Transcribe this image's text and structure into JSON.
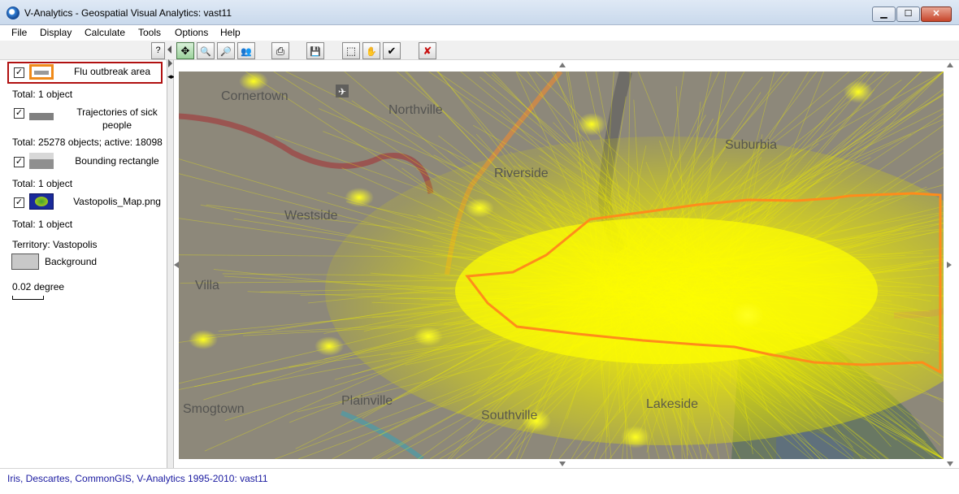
{
  "window": {
    "title": "V-Analytics - Geospatial Visual Analytics: vast11",
    "controls": {
      "minimize": "▁",
      "maximize": "☐",
      "close": "✕"
    }
  },
  "menu": [
    "File",
    "Display",
    "Calculate",
    "Tools",
    "Options",
    "Help"
  ],
  "toolbar": {
    "help_label": "?",
    "buttons": [
      {
        "name": "pan-grid-icon",
        "glyph": "✥",
        "active": true
      },
      {
        "name": "zoom-in-icon",
        "glyph": "🔍"
      },
      {
        "name": "zoom-out-icon",
        "glyph": "🔎"
      },
      {
        "name": "find-people-icon",
        "glyph": "👥"
      },
      {
        "name": "print-icon",
        "glyph": "⎙"
      },
      {
        "name": "save-icon",
        "glyph": "💾"
      },
      {
        "name": "select-rectangle-icon",
        "glyph": "⬚"
      },
      {
        "name": "hand-icon",
        "glyph": "✋"
      },
      {
        "name": "checkmark-icon",
        "glyph": "✔"
      },
      {
        "name": "remove-icon",
        "glyph": "✘"
      }
    ]
  },
  "legend": {
    "layers": [
      {
        "label": "Flu outbreak area",
        "checked": true,
        "info": "Total: 1 object"
      },
      {
        "label": "Trajectories of sick people",
        "checked": true,
        "info": "Total: 25278 objects; active: 18098"
      },
      {
        "label": "Bounding rectangle",
        "checked": true,
        "info": "Total: 1 object"
      },
      {
        "label": "Vastopolis_Map.png",
        "checked": true,
        "info": "Total: 1 object"
      }
    ],
    "territory": "Territory: Vastopolis",
    "background_label": "Background",
    "scale": "0.02 degree",
    "colors": {
      "outbreak_border": "#f08a1a",
      "trajectory": "#808080",
      "background_swatch": "#c8c8c8"
    }
  },
  "map": {
    "place_names": [
      "Cornertown",
      "Northville",
      "Suburbia",
      "Villa",
      "Smogtown",
      "Plainville",
      "Southville",
      "Lakeside",
      "Westside",
      "Riverside"
    ],
    "colors": {
      "trajectories": "#f2f000",
      "outbreak_outline": "#ff8c1a",
      "base_tint": "#7a7a6a"
    }
  },
  "status": "Iris, Descartes, CommonGIS, V-Analytics 1995-2010: vast11"
}
